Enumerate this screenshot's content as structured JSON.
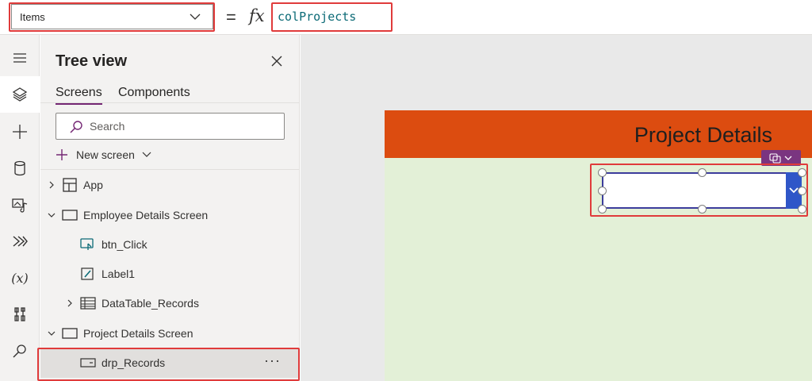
{
  "formula_bar": {
    "property": "Items",
    "equals": "=",
    "fx": "fx",
    "formula": "colProjects"
  },
  "rail": {
    "items": [
      "menu-icon",
      "layers-icon",
      "add-icon",
      "data-icon",
      "media-icon",
      "flow-icon",
      "variables-icon",
      "tools-icon",
      "search-icon"
    ],
    "variables_label": "(x)"
  },
  "tree_view": {
    "title": "Tree view",
    "tabs": [
      "Screens",
      "Components"
    ],
    "search_placeholder": "Search",
    "new_screen": "New screen",
    "nodes": [
      {
        "label": "App"
      },
      {
        "label": "Employee Details Screen"
      },
      {
        "label": "btn_Click"
      },
      {
        "label": "Label1"
      },
      {
        "label": "DataTable_Records"
      },
      {
        "label": "Project Details Screen"
      },
      {
        "label": "drp_Records",
        "more": "···"
      }
    ]
  },
  "canvas": {
    "header_title": "Project Details"
  },
  "colors": {
    "accent": "#742774",
    "header": "#dc4c10",
    "screen_bg": "#e3f0d7",
    "highlight_box": "#e03b3b",
    "formula_text": "#0b6a76"
  }
}
